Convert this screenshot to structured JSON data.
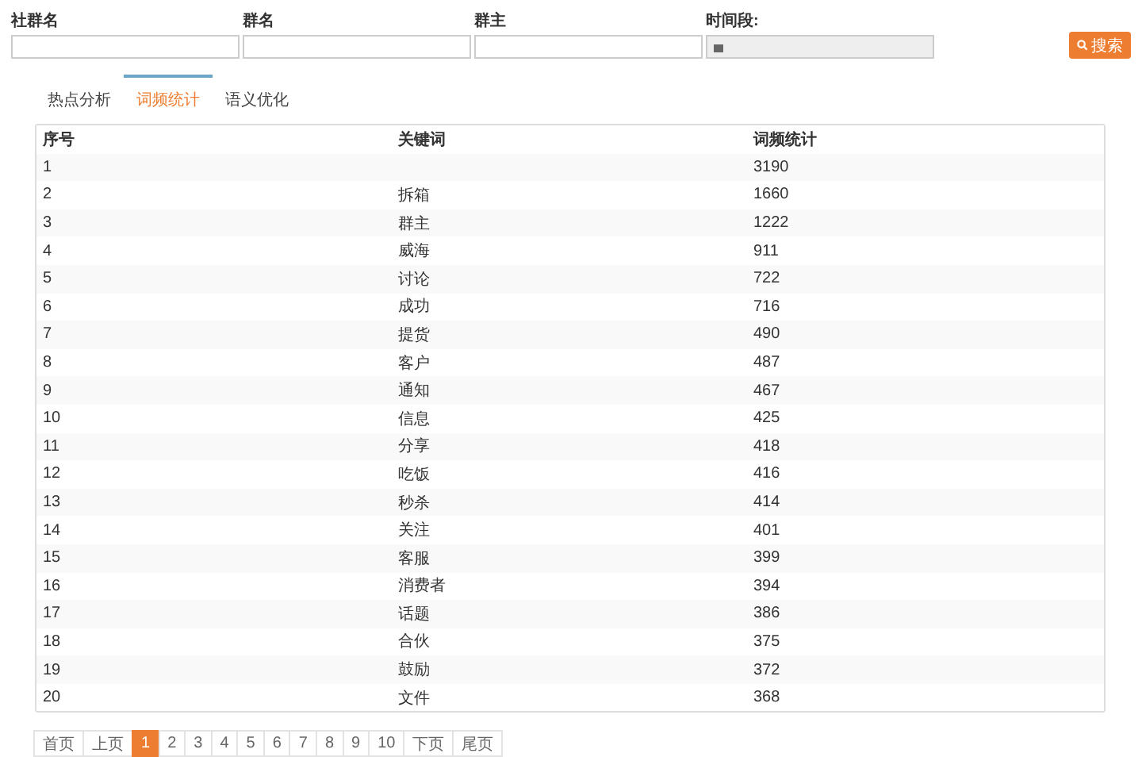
{
  "filters": [
    {
      "label": "社群名",
      "kind": "text"
    },
    {
      "label": "群名",
      "kind": "text"
    },
    {
      "label": "群主",
      "kind": "text"
    },
    {
      "label": "时间段:",
      "kind": "date"
    }
  ],
  "search_button": {
    "label": "搜索"
  },
  "tabs": [
    {
      "label": "热点分析",
      "selected": false
    },
    {
      "label": "词频统计",
      "selected": true
    },
    {
      "label": "语义优化",
      "selected": false
    }
  ],
  "table": {
    "columns": [
      "序号",
      "关键词",
      "词频统计"
    ],
    "rows": [
      [
        "1",
        "",
        "3190"
      ],
      [
        "2",
        "拆箱",
        "1660"
      ],
      [
        "3",
        "群主",
        "1222"
      ],
      [
        "4",
        "威海",
        "911"
      ],
      [
        "5",
        "讨论",
        "722"
      ],
      [
        "6",
        "成功",
        "716"
      ],
      [
        "7",
        "提货",
        "490"
      ],
      [
        "8",
        "客户",
        "487"
      ],
      [
        "9",
        "通知",
        "467"
      ],
      [
        "10",
        "信息",
        "425"
      ],
      [
        "11",
        "分享",
        "418"
      ],
      [
        "12",
        "吃饭",
        "416"
      ],
      [
        "13",
        "秒杀",
        "414"
      ],
      [
        "14",
        "关注",
        "401"
      ],
      [
        "15",
        "客服",
        "399"
      ],
      [
        "16",
        "消费者",
        "394"
      ],
      [
        "17",
        "话题",
        "386"
      ],
      [
        "18",
        "合伙",
        "375"
      ],
      [
        "19",
        "鼓励",
        "372"
      ],
      [
        "20",
        "文件",
        "368"
      ]
    ]
  },
  "pagination": [
    {
      "label": "首页",
      "selected": false
    },
    {
      "label": "上页",
      "selected": false
    },
    {
      "label": "1",
      "selected": true
    },
    {
      "label": "2",
      "selected": false
    },
    {
      "label": "3",
      "selected": false
    },
    {
      "label": "4",
      "selected": false
    },
    {
      "label": "5",
      "selected": false
    },
    {
      "label": "6",
      "selected": false
    },
    {
      "label": "7",
      "selected": false
    },
    {
      "label": "8",
      "selected": false
    },
    {
      "label": "9",
      "selected": false
    },
    {
      "label": "10",
      "selected": false
    },
    {
      "label": "下页",
      "selected": false
    },
    {
      "label": "尾页",
      "selected": false
    }
  ]
}
